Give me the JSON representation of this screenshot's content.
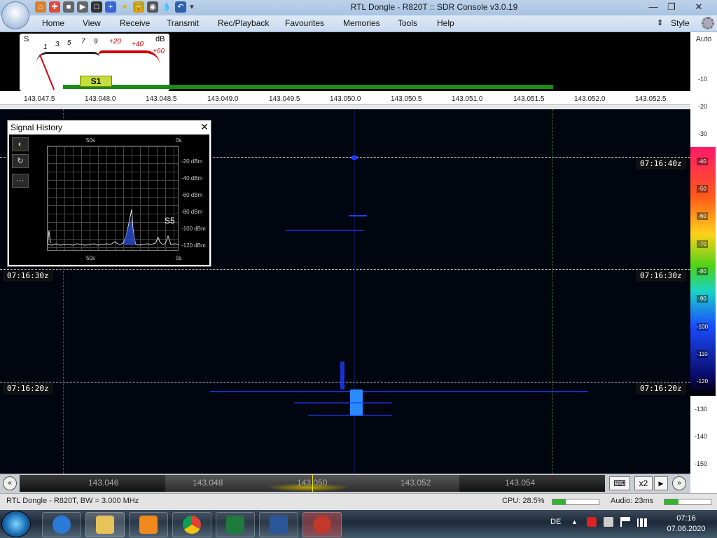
{
  "window": {
    "title": "RTL Dongle - R820T :: SDR Console v3.0.19",
    "minimize": "—",
    "restore": "❐",
    "close": "✕"
  },
  "menu": {
    "items": [
      "Home",
      "View",
      "Receive",
      "Transmit",
      "Rec/Playback",
      "Favourites",
      "Memories",
      "Tools",
      "Help"
    ],
    "style_label": "Style"
  },
  "smeter": {
    "s_label": "S",
    "db_label": "dB",
    "scale": [
      "1",
      "3",
      "5",
      "7",
      "9",
      "+20",
      "+40",
      "+60"
    ],
    "reading": "S1"
  },
  "freq_ticks": [
    "143.047.5",
    "143.048.0",
    "143.048.5",
    "143.049.0",
    "143.049.5",
    "143.050.0",
    "143.050.5",
    "143.051.0",
    "143.051.5",
    "143.052.0",
    "143.052.5"
  ],
  "side_scale": {
    "auto": "Auto",
    "top_ticks": [
      "-10",
      "-20",
      "-30"
    ],
    "color_ticks": [
      "-40",
      "-50",
      "-60",
      "-70",
      "-80",
      "-90",
      "-100",
      "-110",
      "-120"
    ],
    "bottom_ticks": [
      "-130",
      "-140",
      "-150"
    ]
  },
  "waterfall": {
    "timestamps": [
      "07:16:40z",
      "07:16:30z",
      "07:16:20z"
    ]
  },
  "signal_history": {
    "title": "Signal History",
    "close": "✕",
    "top_left": "50s",
    "top_right": "0s",
    "bottom_left": "50s",
    "bottom_right": "0s",
    "y_labels": [
      "-20 dBm",
      "-40 dBm",
      "-60 dBm",
      "-80 dBm",
      "-100 dBm",
      "-120 dBm"
    ],
    "s_reading": "S5",
    "buttons": [
      "◐",
      "↻",
      "···"
    ]
  },
  "tuner": {
    "freqs": [
      "143.046",
      "143.048",
      "143.050",
      "143.052",
      "143.054"
    ],
    "zoom": "x2",
    "left_arrow": "«",
    "right_arrow": "»",
    "play": "▶"
  },
  "status": {
    "device": "RTL Dongle - R820T, BW = 3.000 MHz",
    "cpu": "CPU: 28.5%",
    "cpu_level": 0.285,
    "audio": "Audio: 23ms",
    "audio_level": 0.3
  },
  "taskbar": {
    "lang": "DE",
    "time": "07:16",
    "date": "07.06.2020"
  },
  "colors": {
    "waterfall_bg": "#000510",
    "signal_blue": "#1e3cff",
    "meter_green": "#1d8a1a"
  }
}
